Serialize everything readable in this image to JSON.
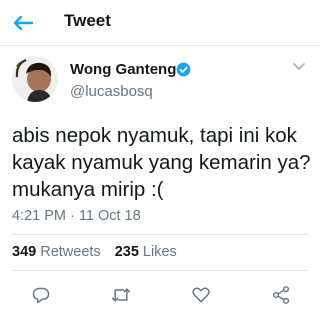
{
  "header": {
    "title": "Tweet",
    "back_icon": "arrow-left-icon",
    "accent": "#1da1f2"
  },
  "tweet": {
    "display_name": "Wong Ganteng",
    "handle": "@lucasbosq",
    "verified": true,
    "text": "abis nepok nyamuk, tapi ini kok kayak nyamuk yang kemarin ya? mukanya mirip :(",
    "timestamp": "4:21 PM · 11 Oct 18"
  },
  "stats": {
    "retweets_count": "349",
    "retweets_label": "Retweets",
    "likes_count": "235",
    "likes_label": "Likes"
  },
  "actions": [
    "reply-icon",
    "retweet-icon",
    "like-icon",
    "share-icon"
  ]
}
